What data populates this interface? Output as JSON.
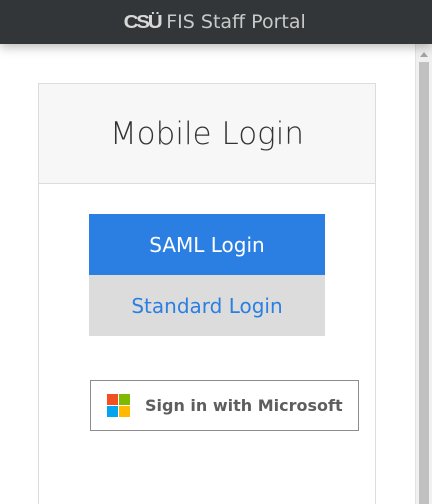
{
  "header": {
    "logo_text": "CSÜ",
    "title": "FIS Staff Portal",
    "background": "#323639"
  },
  "login_panel": {
    "title": "Mobile Login",
    "saml_button_label": "SAML Login",
    "standard_button_label": "Standard Login",
    "microsoft_button_label": "Sign in with Microsoft"
  },
  "colors": {
    "primary": "#2b7fe3",
    "secondary_bg": "#dcdcdc",
    "ms_red": "#f25022",
    "ms_green": "#7fba00",
    "ms_blue": "#00a4ef",
    "ms_yellow": "#ffb900"
  },
  "icons": {
    "brand": "csu-logo-icon",
    "microsoft": "microsoft-logo-icon",
    "scroll_up": "scroll-up-arrow-icon"
  }
}
